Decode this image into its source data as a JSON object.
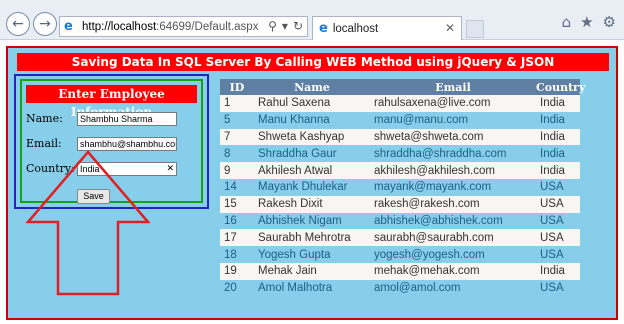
{
  "browser": {
    "url_host": "http://localhost",
    "url_rest": ":64699/Default.aspx",
    "tab_title": "localhost"
  },
  "page": {
    "title": "Saving Data In SQL Server By Calling WEB Method using jQuery & JSON",
    "frame_color": "#d10000",
    "background_color": "#87ceeb"
  },
  "form": {
    "heading": "Enter Employee Information",
    "name_label": "Name:",
    "name_value": "Shambhu Sharma",
    "email_label": "Email:",
    "email_value": "shambhu@shambhu.con",
    "country_label": "Country:",
    "country_value": "India",
    "save_label": "Save"
  },
  "table": {
    "columns": [
      "ID",
      "Name",
      "Email",
      "Country"
    ],
    "rows": [
      [
        "1",
        "Rahul Saxena",
        "rahulsaxena@live.com",
        "India"
      ],
      [
        "5",
        "Manu Khanna",
        "manu@manu.com",
        "India"
      ],
      [
        "7",
        "Shweta Kashyap",
        "shweta@shweta.com",
        "India"
      ],
      [
        "8",
        "Shraddha Gaur",
        "shraddha@shraddha.com",
        "India"
      ],
      [
        "9",
        "Akhilesh Atwal",
        "akhilesh@akhilesh.com",
        "India"
      ],
      [
        "14",
        "Mayank Dhulekar",
        "mayank@mayank.com",
        "USA"
      ],
      [
        "15",
        "Rakesh Dixit",
        "rakesh@rakesh.com",
        "USA"
      ],
      [
        "16",
        "Abhishek Nigam",
        "abhishek@abhishek.com",
        "USA"
      ],
      [
        "17",
        "Saurabh Mehrotra",
        "saurabh@saurabh.com",
        "USA"
      ],
      [
        "18",
        "Yogesh Gupta",
        "yogesh@yogesh.com",
        "USA"
      ],
      [
        "19",
        "Mehak Jain",
        "mehak@mehak.com",
        "India"
      ],
      [
        "20",
        "Amol Malhotra",
        "amol@amol.com",
        "USA"
      ]
    ]
  },
  "icons": {
    "back": "back-arrow-icon",
    "forward": "forward-arrow-icon",
    "home": "home-icon",
    "favorites": "star-icon",
    "settings": "gear-icon",
    "annotation": "red-up-arrow-icon"
  }
}
